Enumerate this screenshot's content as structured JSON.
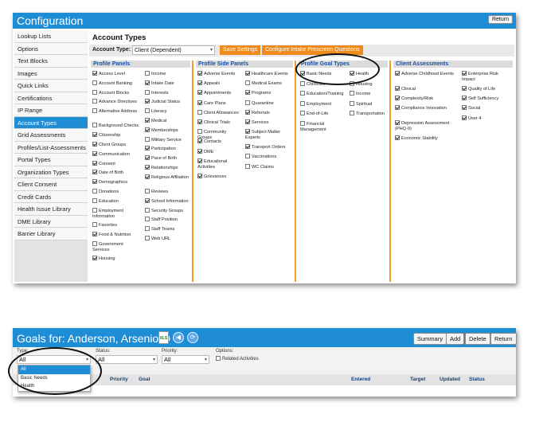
{
  "config": {
    "title": "Configuration",
    "return_label": "Return",
    "sidebar": {
      "items": [
        {
          "label": "Lookup Lists",
          "active": false
        },
        {
          "label": "Options",
          "active": false
        },
        {
          "label": "Text Blocks",
          "active": false
        },
        {
          "label": "Images",
          "active": false
        },
        {
          "label": "Quick Links",
          "active": false
        },
        {
          "label": "Certifications",
          "active": false
        },
        {
          "label": "IP Range",
          "active": false
        },
        {
          "label": "Account Types",
          "active": true
        },
        {
          "label": "Grid Assessments",
          "active": false
        },
        {
          "label": "Profiles/List-Assessments",
          "active": false
        },
        {
          "label": "Portal Types",
          "active": false
        },
        {
          "label": "Organization Types",
          "active": false
        },
        {
          "label": "Client Consent",
          "active": false
        },
        {
          "label": "Credit Cards",
          "active": false
        },
        {
          "label": "Health Issue Library",
          "active": false
        },
        {
          "label": "DME Library",
          "active": false
        },
        {
          "label": "Barrier Library",
          "active": false
        }
      ]
    },
    "page_title": "Account Types",
    "account_type_label": "Account Type:",
    "account_type_value": "Client (Dependent)",
    "save_label": "Save Settings",
    "configure_label": "Configure Intake Prescreen Questions",
    "panels": {
      "profile_panels": {
        "title": "Profile Panels",
        "col1": [
          {
            "label": "Access Level",
            "checked": true
          },
          {
            "label": "Account Banking",
            "checked": false
          },
          {
            "label": "Account Blocks",
            "checked": false
          },
          {
            "label": "Advance Directives",
            "checked": false
          },
          {
            "label": "Alternative Address",
            "checked": false
          },
          {
            "label": "Background Checks",
            "checked": false
          },
          {
            "label": "Citizenship",
            "checked": true
          },
          {
            "label": "Client Groups",
            "checked": true
          },
          {
            "label": "Communication",
            "checked": true
          },
          {
            "label": "Consent",
            "checked": true
          },
          {
            "label": "Date of Birth",
            "checked": true
          },
          {
            "label": "Demographics",
            "checked": true
          },
          {
            "label": "Donations",
            "checked": false
          },
          {
            "label": "Education",
            "checked": false
          },
          {
            "label": "Employment Information",
            "checked": false
          },
          {
            "label": "Favorites",
            "checked": false
          },
          {
            "label": "Food & Nutrition",
            "checked": true
          },
          {
            "label": "Government Services",
            "checked": false
          },
          {
            "label": "Housing",
            "checked": true
          }
        ],
        "col2": [
          {
            "label": "Income",
            "checked": false
          },
          {
            "label": "Intake Date",
            "checked": true
          },
          {
            "label": "Interests",
            "checked": false
          },
          {
            "label": "Judicial Status",
            "checked": true
          },
          {
            "label": "Literacy",
            "checked": false
          },
          {
            "label": "Medical",
            "checked": true
          },
          {
            "label": "Memberships",
            "checked": true
          },
          {
            "label": "Military Service",
            "checked": false
          },
          {
            "label": "Participation",
            "checked": true
          },
          {
            "label": "Pace of Birth",
            "checked": true
          },
          {
            "label": "Relationships",
            "checked": true
          },
          {
            "label": "Religious Affiliation",
            "checked": true
          },
          {
            "label": "Reviews",
            "checked": false
          },
          {
            "label": "School Information",
            "checked": true
          },
          {
            "label": "Security Groups",
            "checked": false
          },
          {
            "label": "Staff Position",
            "checked": false
          },
          {
            "label": "Staff Teams",
            "checked": false
          },
          {
            "label": "Web URL",
            "checked": false
          }
        ]
      },
      "profile_side_panels": {
        "title": "Profile Side Panels",
        "col1": [
          {
            "label": "Adverse Events",
            "checked": true
          },
          {
            "label": "Appeals",
            "checked": true
          },
          {
            "label": "Appointments",
            "checked": true
          },
          {
            "label": "Care Plans",
            "checked": true
          },
          {
            "label": "Client Allowances",
            "checked": false
          },
          {
            "label": "Clinical Trials",
            "checked": true
          },
          {
            "label": "Community Groups",
            "checked": false
          },
          {
            "label": "Contacts",
            "checked": true
          },
          {
            "label": "DME",
            "checked": true
          },
          {
            "label": "Educational Activities",
            "checked": true
          },
          {
            "label": "Grievances",
            "checked": true
          }
        ],
        "col2": [
          {
            "label": "Healthcare Events",
            "checked": true
          },
          {
            "label": "Medical Exams",
            "checked": false
          },
          {
            "label": "Programs",
            "checked": true
          },
          {
            "label": "Quarantine",
            "checked": false
          },
          {
            "label": "Referrals",
            "checked": true
          },
          {
            "label": "Services",
            "checked": true
          },
          {
            "label": "Subject Matter Experts",
            "checked": true
          },
          {
            "label": "Transport Orders",
            "checked": true
          },
          {
            "label": "Vaccinations",
            "checked": false
          },
          {
            "label": "WC Claims",
            "checked": false
          }
        ]
      },
      "profile_goal_types": {
        "title": "Profile Goal Types",
        "col1": [
          {
            "label": "Basic Needs",
            "checked": true
          },
          {
            "label": "Childcare",
            "checked": false
          },
          {
            "label": "Education/Training",
            "checked": false
          },
          {
            "label": "Employment",
            "checked": false
          },
          {
            "label": "End-of-Life",
            "checked": false
          },
          {
            "label": "Financial Management",
            "checked": false
          }
        ],
        "col2": [
          {
            "label": "Health",
            "checked": true
          },
          {
            "label": "Housing",
            "checked": false
          },
          {
            "label": "Income",
            "checked": false
          },
          {
            "label": "Spiritual",
            "checked": false
          },
          {
            "label": "Transportation",
            "checked": false
          }
        ]
      },
      "client_assessments": {
        "title": "Client Assessments",
        "col1": [
          {
            "label": "Adverse Childhood Events",
            "checked": true
          },
          {
            "label": "Clinical",
            "checked": true
          },
          {
            "label": "Complexity/Risk",
            "checked": true
          },
          {
            "label": "Compliance Innovation",
            "checked": true
          },
          {
            "label": "Depression Assessment (PHQ-9)",
            "checked": true
          },
          {
            "label": "Economic Stability",
            "checked": true
          }
        ],
        "col2": [
          {
            "label": "Enterprise Risk Impact",
            "checked": true
          },
          {
            "label": "Quality of Life",
            "checked": true
          },
          {
            "label": "Self Sufficiency",
            "checked": true
          },
          {
            "label": "Social",
            "checked": true
          },
          {
            "label": "User 4",
            "checked": true
          }
        ]
      }
    }
  },
  "goals": {
    "title": "Goals for: Anderson, Arsenio O",
    "xls_label": "XLS",
    "summary_label": "Summary",
    "add_label": "Add",
    "delete_label": "Delete",
    "return_label": "Return",
    "filters": {
      "type_label": "Type:",
      "type_value": "All",
      "status_label": "Status:",
      "status_value": "All",
      "priority_label": "Priority:",
      "priority_value": "All",
      "options_label": "Options:",
      "related_label": "Related Activities"
    },
    "type_options": [
      "All",
      "Basic Needs",
      "Health"
    ],
    "columns": {
      "priority": "Priority",
      "goal": "Goal",
      "entered": "Entered",
      "target": "Target",
      "updated": "Updated",
      "status": "Status"
    }
  }
}
